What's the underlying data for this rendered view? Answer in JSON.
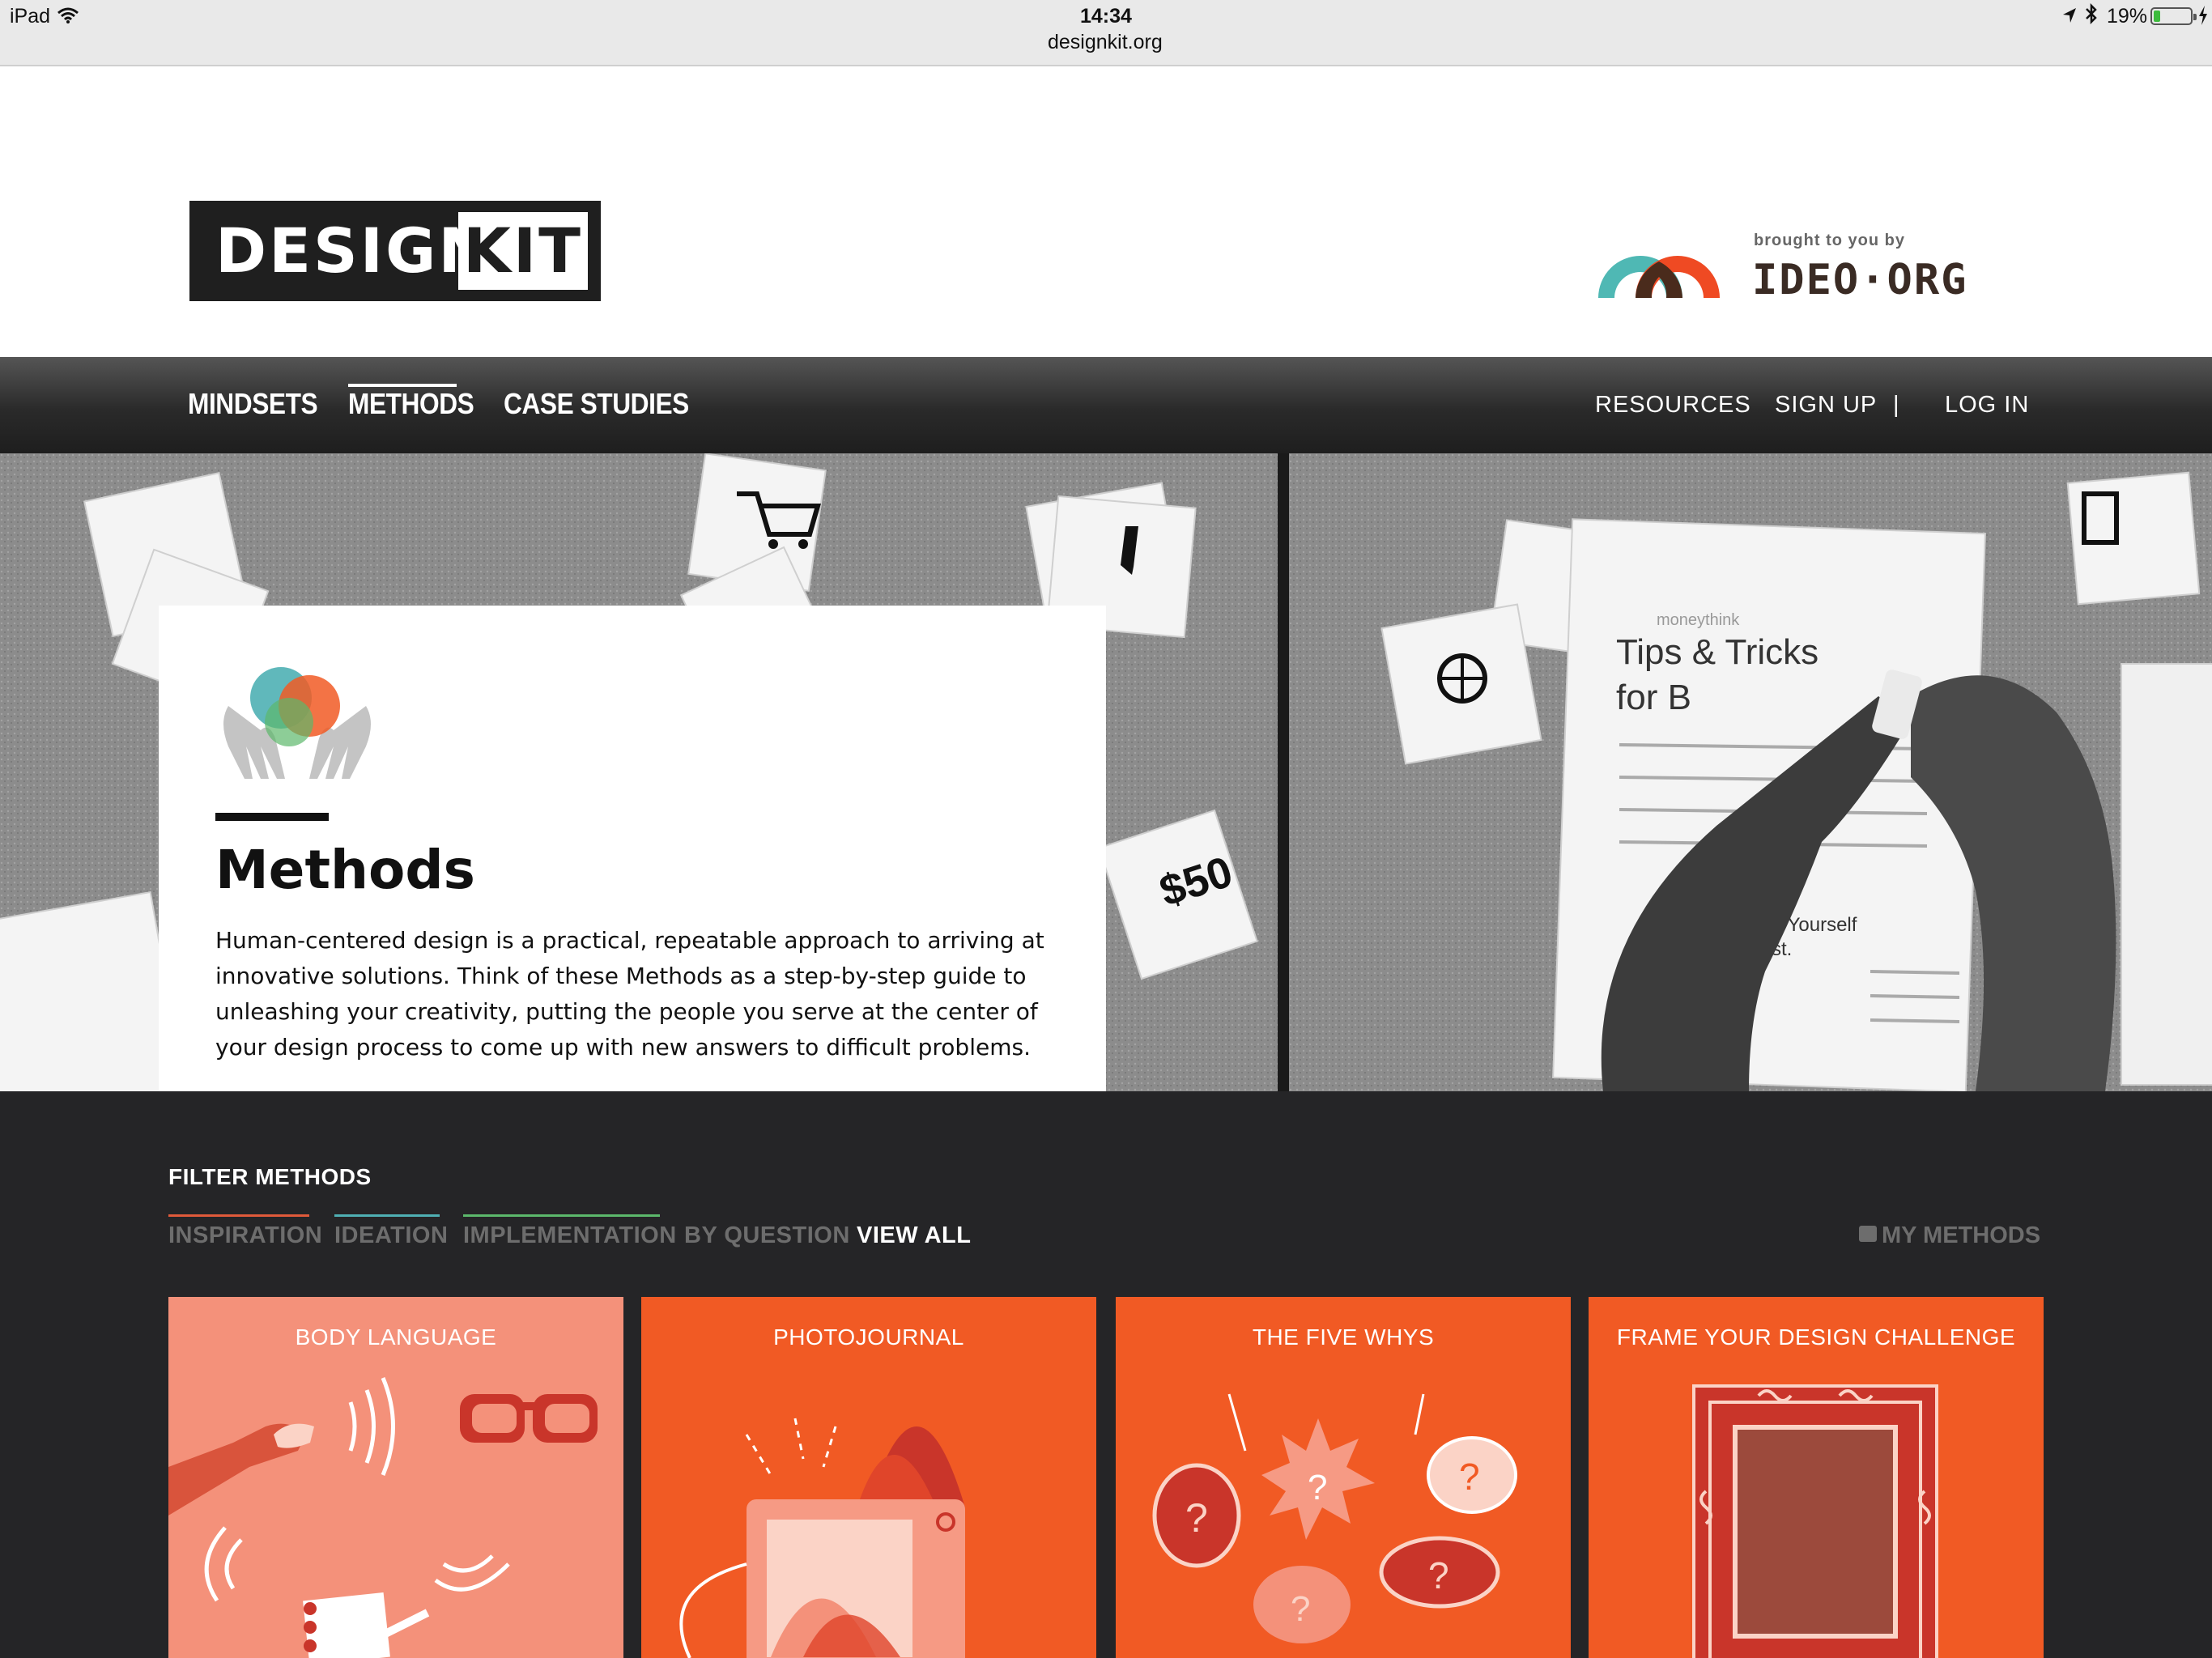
{
  "status_bar": {
    "device": "iPad",
    "time": "14:34",
    "url": "designkit.org",
    "battery": "19%",
    "battery_level": 0.19
  },
  "header": {
    "logo_word_1": "DESIGN",
    "logo_word_2": "KIT",
    "brought_by": "brought to you by",
    "partner_name": "IDEO·ORG"
  },
  "nav": {
    "left": [
      "MINDSETS",
      "METHODS",
      "CASE STUDIES"
    ],
    "active": "METHODS",
    "right": [
      "RESOURCES",
      "SIGN UP",
      "|",
      "LOG IN"
    ]
  },
  "hero": {
    "title": "Methods",
    "description": "Human-centered design is a practical, repeatable approach to arriving at innovative solutions. Think of these Methods as a step-by-step guide to unleashing your creativity, putting the people you serve at the center of your design process to come up with new answers to difficult problems.",
    "photo_text": [
      "Tips & Tricks",
      "for B",
      "moneythink",
      "$50",
      "Pay Yourself",
      "First."
    ]
  },
  "filter": {
    "title": "FILTER METHODS",
    "tabs": [
      {
        "label": "INSPIRATION",
        "color": "#e05a3a"
      },
      {
        "label": "IDEATION",
        "color": "#4fb0b4"
      },
      {
        "label": "IMPLEMENTATION",
        "color": "#5cb86b"
      },
      {
        "label": "BY QUESTION",
        "color": ""
      },
      {
        "label": "VIEW ALL",
        "color": ""
      }
    ],
    "my_methods": "MY METHODS"
  },
  "methods": [
    {
      "title": "BODY LANGUAGE",
      "bg": "#f4917a"
    },
    {
      "title": "PHOTOJOURNAL",
      "bg": "#f15a24"
    },
    {
      "title": "THE FIVE WHYS",
      "bg": "#f15a24"
    },
    {
      "title": "FRAME YOUR DESIGN CHALLENGE",
      "bg": "#f15a24"
    }
  ],
  "colors": {
    "accent_orange": "#f15a24",
    "accent_salmon": "#f4917a",
    "dark_bg": "#252527",
    "teal": "#4fb0b4"
  }
}
